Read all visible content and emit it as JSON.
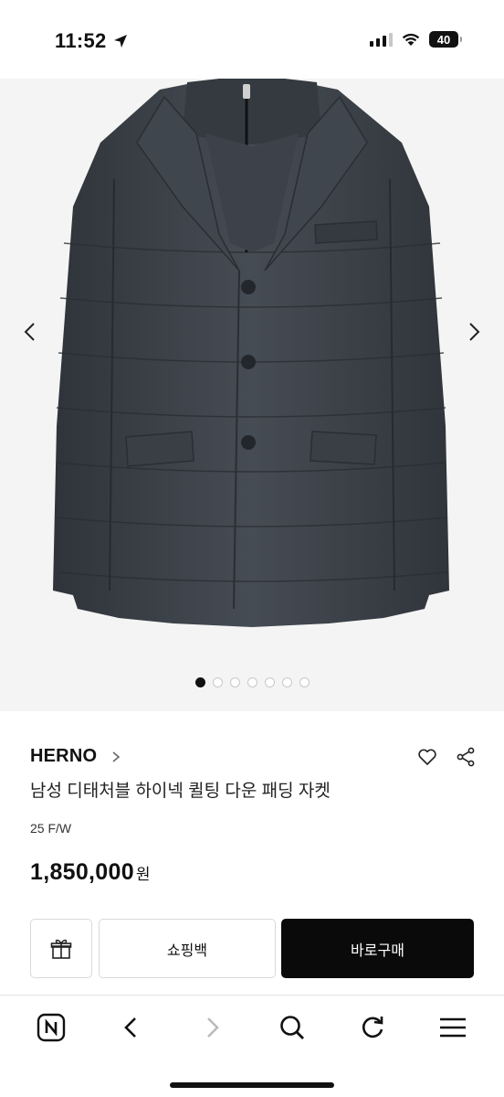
{
  "status": {
    "time": "11:52",
    "battery": "40",
    "icons": [
      "location-arrow-icon",
      "cellular-signal-icon",
      "wifi-icon",
      "battery-icon"
    ]
  },
  "gallery": {
    "image": "navy-quilted-down-blazer-jacket",
    "total_images": 7,
    "active_index": 0,
    "icons": [
      "chevron-left-icon",
      "chevron-right-icon"
    ]
  },
  "product": {
    "brand": "HERNO",
    "title": "남성 디태처블 하이넥 퀼팅 다운 패딩 자켓",
    "season": "25 F/W",
    "price": "1,850,000",
    "currency": "원",
    "icons": [
      "chevron-right-icon",
      "heart-icon",
      "share-icon"
    ]
  },
  "buttons": {
    "gift_icon": "gift-icon",
    "shopping_bag": "쇼핑백",
    "buy_now": "바로구매"
  },
  "browser_nav": {
    "icons": [
      "naver-home-icon",
      "back-icon",
      "forward-icon",
      "search-icon",
      "reload-icon",
      "menu-icon"
    ]
  },
  "colors": {
    "primary_button": "#0a0a0a",
    "gallery_bg": "#f4f4f4",
    "jacket": "#3c4148"
  }
}
